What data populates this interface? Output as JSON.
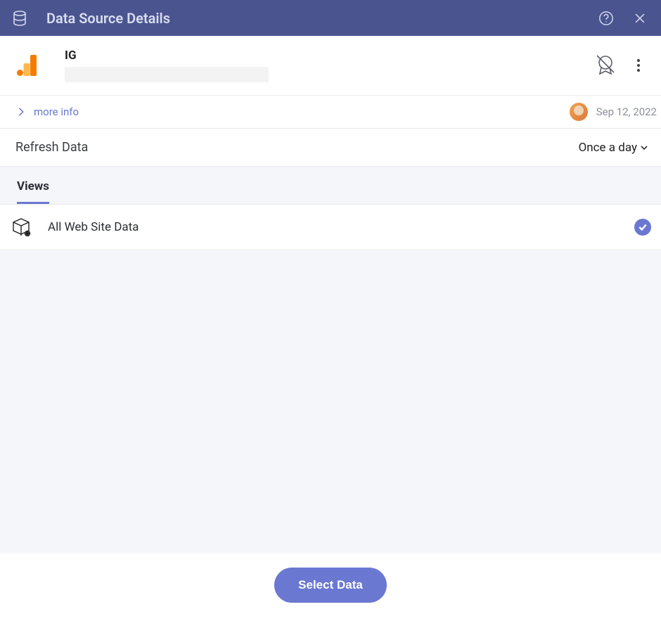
{
  "titlebar": {
    "title": "Data Source Details"
  },
  "source": {
    "name": "IG"
  },
  "meta": {
    "more_info": "more info",
    "date": "Sep 12, 2022"
  },
  "refresh": {
    "label": "Refresh Data",
    "value": "Once a day"
  },
  "tabs": {
    "views": "Views"
  },
  "views": [
    {
      "name": "All Web Site Data"
    }
  ],
  "footer": {
    "select": "Select Data"
  }
}
